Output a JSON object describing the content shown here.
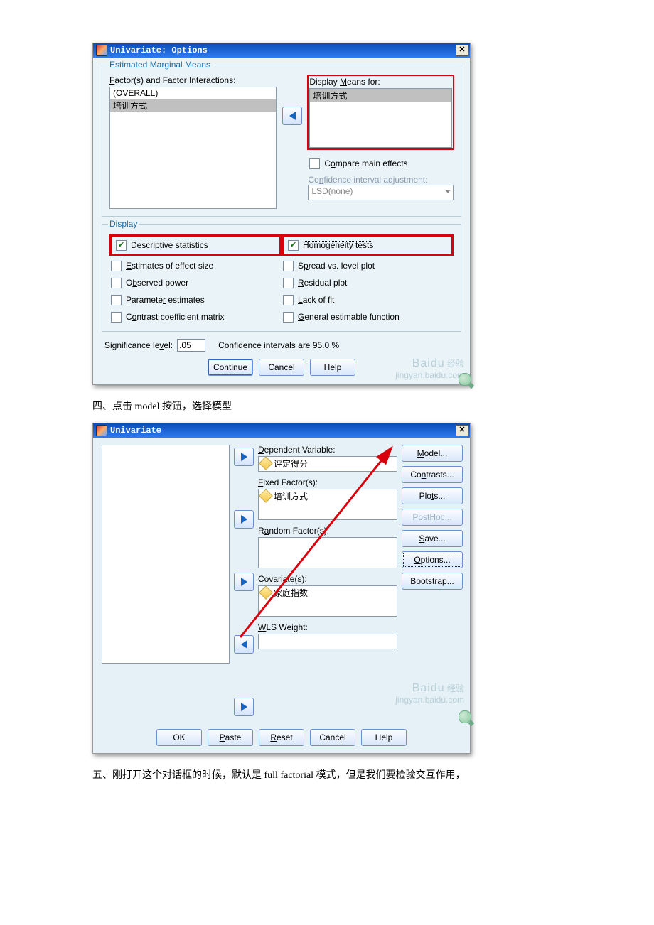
{
  "dlg1": {
    "title": "Univariate: Options",
    "gb_emm": "Estimated Marginal Means",
    "factors_label": "Factor(s) and Factor Interactions:",
    "factors": [
      "(OVERALL)",
      "培训方式"
    ],
    "display_means_label": "Display Means for:",
    "display_means": [
      "培训方式"
    ],
    "compare_main": "Compare main effects",
    "ci_adjust_label": "Confidence interval adjustment:",
    "ci_adjust_value": "LSD(none)",
    "gb_display": "Display",
    "opts_left": {
      "desc": "Descriptive statistics",
      "effect": "Estimates of effect size",
      "obs": "Observed power",
      "param": "Parameter estimates",
      "contrast": "Contrast coefficient matrix"
    },
    "opts_right": {
      "homo": "Homogeneity tests",
      "spread": "Spread vs. level plot",
      "resid": "Residual plot",
      "lack": "Lack of fit",
      "gest": "General estimable function"
    },
    "sig_label": "Significance level:",
    "sig_value": ".05",
    "ci_text": "Confidence intervals are 95.0 %",
    "btn_continue": "Continue",
    "btn_cancel": "Cancel",
    "btn_help": "Help",
    "wm1": "Bai",
    "wm2": "经验",
    "wm3": "jingyan.baidu.com"
  },
  "cap1": "四、点击 model 按钮，选择模型",
  "dlg2": {
    "title": "Univariate",
    "dep_label": "Dependent Variable:",
    "dep_value": "评定得分",
    "fixed_label": "Fixed Factor(s):",
    "fixed_value": "培训方式",
    "random_label": "Random Factor(s):",
    "cov_label": "Covariate(s):",
    "cov_value": "家庭指数",
    "wls_label": "WLS Weight:",
    "btns_side": {
      "model": "Model...",
      "contrasts": "Contrasts...",
      "plots": "Plots...",
      "posthoc": "Post Hoc...",
      "save": "Save...",
      "options": "Options...",
      "bootstrap": "Bootstrap..."
    },
    "bottom": {
      "ok": "OK",
      "paste": "Paste",
      "reset": "Reset",
      "cancel": "Cancel",
      "help": "Help"
    },
    "wm1": "Bai",
    "wm2": "经验",
    "wm3": "jingyan.baidu.com"
  },
  "cap2": "五、刚打开这个对话框的时候，默认是 full factorial 模式，但是我们要检验交互作用，"
}
